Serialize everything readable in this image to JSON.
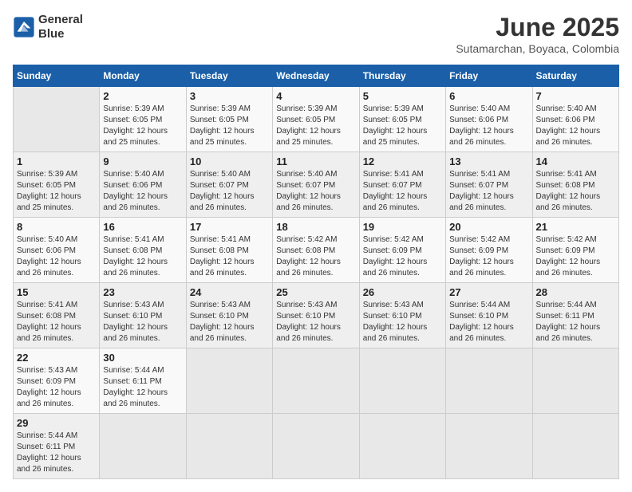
{
  "header": {
    "logo_line1": "General",
    "logo_line2": "Blue",
    "title": "June 2025",
    "subtitle": "Sutamarchan, Boyaca, Colombia"
  },
  "calendar": {
    "days_of_week": [
      "Sunday",
      "Monday",
      "Tuesday",
      "Wednesday",
      "Thursday",
      "Friday",
      "Saturday"
    ],
    "weeks": [
      [
        {
          "day": "",
          "info": ""
        },
        {
          "day": "2",
          "info": "Sunrise: 5:39 AM\nSunset: 6:05 PM\nDaylight: 12 hours\nand 25 minutes."
        },
        {
          "day": "3",
          "info": "Sunrise: 5:39 AM\nSunset: 6:05 PM\nDaylight: 12 hours\nand 25 minutes."
        },
        {
          "day": "4",
          "info": "Sunrise: 5:39 AM\nSunset: 6:05 PM\nDaylight: 12 hours\nand 25 minutes."
        },
        {
          "day": "5",
          "info": "Sunrise: 5:39 AM\nSunset: 6:05 PM\nDaylight: 12 hours\nand 25 minutes."
        },
        {
          "day": "6",
          "info": "Sunrise: 5:40 AM\nSunset: 6:06 PM\nDaylight: 12 hours\nand 26 minutes."
        },
        {
          "day": "7",
          "info": "Sunrise: 5:40 AM\nSunset: 6:06 PM\nDaylight: 12 hours\nand 26 minutes."
        }
      ],
      [
        {
          "day": "1",
          "info": "Sunrise: 5:39 AM\nSunset: 6:05 PM\nDaylight: 12 hours\nand 25 minutes."
        },
        {
          "day": "9",
          "info": "Sunrise: 5:40 AM\nSunset: 6:06 PM\nDaylight: 12 hours\nand 26 minutes."
        },
        {
          "day": "10",
          "info": "Sunrise: 5:40 AM\nSunset: 6:07 PM\nDaylight: 12 hours\nand 26 minutes."
        },
        {
          "day": "11",
          "info": "Sunrise: 5:40 AM\nSunset: 6:07 PM\nDaylight: 12 hours\nand 26 minutes."
        },
        {
          "day": "12",
          "info": "Sunrise: 5:41 AM\nSunset: 6:07 PM\nDaylight: 12 hours\nand 26 minutes."
        },
        {
          "day": "13",
          "info": "Sunrise: 5:41 AM\nSunset: 6:07 PM\nDaylight: 12 hours\nand 26 minutes."
        },
        {
          "day": "14",
          "info": "Sunrise: 5:41 AM\nSunset: 6:08 PM\nDaylight: 12 hours\nand 26 minutes."
        }
      ],
      [
        {
          "day": "8",
          "info": "Sunrise: 5:40 AM\nSunset: 6:06 PM\nDaylight: 12 hours\nand 26 minutes."
        },
        {
          "day": "16",
          "info": "Sunrise: 5:41 AM\nSunset: 6:08 PM\nDaylight: 12 hours\nand 26 minutes."
        },
        {
          "day": "17",
          "info": "Sunrise: 5:41 AM\nSunset: 6:08 PM\nDaylight: 12 hours\nand 26 minutes."
        },
        {
          "day": "18",
          "info": "Sunrise: 5:42 AM\nSunset: 6:08 PM\nDaylight: 12 hours\nand 26 minutes."
        },
        {
          "day": "19",
          "info": "Sunrise: 5:42 AM\nSunset: 6:09 PM\nDaylight: 12 hours\nand 26 minutes."
        },
        {
          "day": "20",
          "info": "Sunrise: 5:42 AM\nSunset: 6:09 PM\nDaylight: 12 hours\nand 26 minutes."
        },
        {
          "day": "21",
          "info": "Sunrise: 5:42 AM\nSunset: 6:09 PM\nDaylight: 12 hours\nand 26 minutes."
        }
      ],
      [
        {
          "day": "15",
          "info": "Sunrise: 5:41 AM\nSunset: 6:08 PM\nDaylight: 12 hours\nand 26 minutes."
        },
        {
          "day": "23",
          "info": "Sunrise: 5:43 AM\nSunset: 6:10 PM\nDaylight: 12 hours\nand 26 minutes."
        },
        {
          "day": "24",
          "info": "Sunrise: 5:43 AM\nSunset: 6:10 PM\nDaylight: 12 hours\nand 26 minutes."
        },
        {
          "day": "25",
          "info": "Sunrise: 5:43 AM\nSunset: 6:10 PM\nDaylight: 12 hours\nand 26 minutes."
        },
        {
          "day": "26",
          "info": "Sunrise: 5:43 AM\nSunset: 6:10 PM\nDaylight: 12 hours\nand 26 minutes."
        },
        {
          "day": "27",
          "info": "Sunrise: 5:44 AM\nSunset: 6:10 PM\nDaylight: 12 hours\nand 26 minutes."
        },
        {
          "day": "28",
          "info": "Sunrise: 5:44 AM\nSunset: 6:11 PM\nDaylight: 12 hours\nand 26 minutes."
        }
      ],
      [
        {
          "day": "22",
          "info": "Sunrise: 5:43 AM\nSunset: 6:09 PM\nDaylight: 12 hours\nand 26 minutes."
        },
        {
          "day": "30",
          "info": "Sunrise: 5:44 AM\nSunset: 6:11 PM\nDaylight: 12 hours\nand 26 minutes."
        },
        {
          "day": "",
          "info": ""
        },
        {
          "day": "",
          "info": ""
        },
        {
          "day": "",
          "info": ""
        },
        {
          "day": "",
          "info": ""
        },
        {
          "day": "",
          "info": ""
        }
      ],
      [
        {
          "day": "29",
          "info": "Sunrise: 5:44 AM\nSunset: 6:11 PM\nDaylight: 12 hours\nand 26 minutes."
        },
        {
          "day": "",
          "info": ""
        },
        {
          "day": "",
          "info": ""
        },
        {
          "day": "",
          "info": ""
        },
        {
          "day": "",
          "info": ""
        },
        {
          "day": "",
          "info": ""
        },
        {
          "day": "",
          "info": ""
        }
      ]
    ]
  }
}
